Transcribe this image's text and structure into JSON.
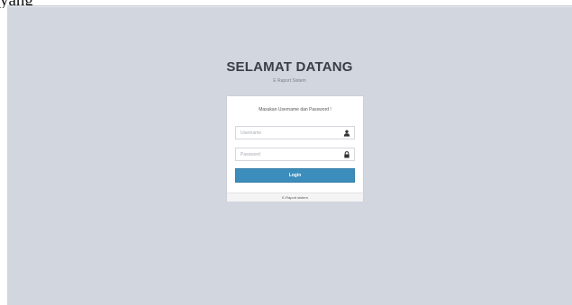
{
  "caption_fragment": "yang",
  "login_page": {
    "title": "SELAMAT DATANG",
    "subtitle": "E Raport Sistem",
    "box": {
      "message": "Masukan Username dan Password !",
      "username": {
        "placeholder": "Username",
        "value": "",
        "icon": "user-icon"
      },
      "password": {
        "placeholder": "Password",
        "value": "",
        "icon": "lock-icon"
      },
      "login_label": "Login",
      "footer": "E-Raport sistem"
    },
    "colors": {
      "background": "#d2d6de",
      "button": "#3c8dbc",
      "title": "#3a3f45"
    }
  }
}
